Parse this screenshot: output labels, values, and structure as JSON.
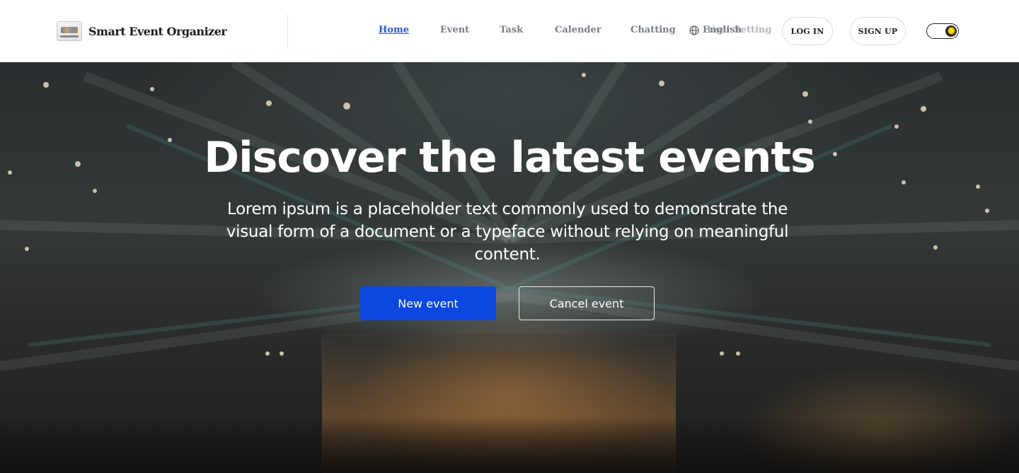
{
  "header": {
    "brand_name": "Smart Event Organizer",
    "nav": [
      {
        "label": "Home",
        "active": true
      },
      {
        "label": "Event",
        "active": false
      },
      {
        "label": "Task",
        "active": false
      },
      {
        "label": "Calender",
        "active": false
      },
      {
        "label": "Chatting",
        "active": false
      }
    ],
    "language_label": "English",
    "language_overlap_label": "User Setting",
    "login_label": "LOG IN",
    "signup_label": "SIGN UP",
    "theme_toggle_icon": "sun-icon"
  },
  "hero": {
    "title": "Discover the latest events",
    "subtitle": "Lorem ipsum is a placeholder text commonly used to demonstrate the visual form of a document or a typeface without relying on meaningful content.",
    "new_event_label": "New event",
    "cancel_event_label": "Cancel event"
  },
  "colors": {
    "accent": "#0c47e0",
    "nav_active": "#2b56d4",
    "nav_text": "#7a7d85",
    "header_bg": "#ffffff"
  }
}
